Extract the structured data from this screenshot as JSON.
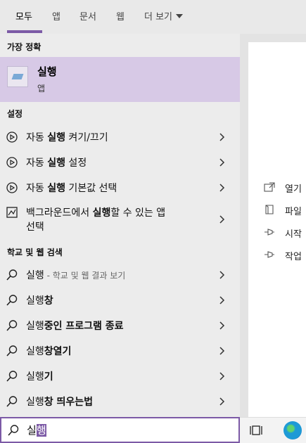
{
  "tabs": [
    {
      "label": "모두"
    },
    {
      "label": "앱"
    },
    {
      "label": "문서"
    },
    {
      "label": "웹"
    },
    {
      "label": "더 보기"
    }
  ],
  "best_match": {
    "header": "가장 정확",
    "title": "실행",
    "subtitle": "앱"
  },
  "settings": {
    "header": "설정",
    "items": [
      {
        "pre": "자동 ",
        "bold": "실행",
        "post": " 켜기/끄기"
      },
      {
        "pre": "자동 ",
        "bold": "실행",
        "post": " 설정"
      },
      {
        "pre": "자동 ",
        "bold": "실행",
        "post": " 기본값 선택"
      },
      {
        "pre": "백그라운드에서 ",
        "bold": "실행",
        "post": "할 수 있는 앱",
        "line2": "선택"
      }
    ]
  },
  "web": {
    "header": "학교 및 웹 검색",
    "items": [
      {
        "base": "실행",
        "rest": "",
        "hint": " - 학교 및 웹 결과 보기"
      },
      {
        "base": "실행",
        "rest": "창"
      },
      {
        "base": "실행",
        "rest": "중인 프로그램 종료"
      },
      {
        "base": "실행",
        "rest": "창열기"
      },
      {
        "base": "실행",
        "rest": "기"
      },
      {
        "base": "실행",
        "rest": "창 띄우는법"
      }
    ]
  },
  "right_panel": {
    "items": [
      {
        "label": "열기",
        "icon": "open-icon"
      },
      {
        "label": "파일",
        "icon": "file-location-icon"
      },
      {
        "label": "시작",
        "icon": "pin-start-icon"
      },
      {
        "label": "작업",
        "icon": "pin-taskbar-icon"
      }
    ]
  },
  "search": {
    "typed": "실",
    "selected": "행"
  },
  "colors": {
    "accent": "#7c5aa6",
    "best_match_bg": "#d7c9e6"
  }
}
